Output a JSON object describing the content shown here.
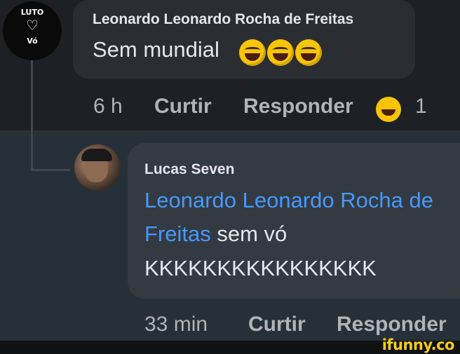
{
  "badge": {
    "line1": "LUTO",
    "symbol": "♡",
    "line2": "Vó"
  },
  "comment": {
    "author": "Leonardo Leonardo Rocha de Freitas",
    "text": "Sem mundial",
    "emojis": [
      "rolling-on-floor-laughing",
      "rolling-on-floor-laughing",
      "rolling-on-floor-laughing"
    ],
    "time": "6 h",
    "like_label": "Curtir",
    "reply_label": "Responder",
    "reaction_emoji": "grinning-face",
    "reaction_count": "1"
  },
  "reply": {
    "author": "Lucas Seven",
    "mention_part1": "Leonardo Leonardo Rocha de",
    "mention_part2": "Freitas",
    "text_after_mention": "sem vó",
    "text_line3": "KKKKKKKKKKKKKKKK",
    "time": "33 min",
    "like_label": "Curtir",
    "reply_label": "Responder"
  },
  "watermark": "ifunny.co",
  "colors": {
    "mention": "#4599ff",
    "background": "#1d2126",
    "bubble": "#2a2e33",
    "watermark": "#f5cc1c"
  }
}
